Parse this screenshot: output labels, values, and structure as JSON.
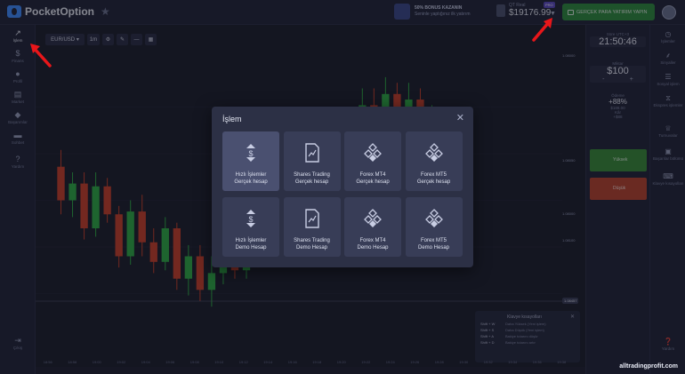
{
  "app": {
    "logo_text": "PocketOption",
    "bonus": {
      "line1": "50% BONUS KAZANIN",
      "line2": "Seninle yaptığınız ilk yatırım"
    },
    "account": {
      "type": "QT Real",
      "balance": "$19176.99",
      "badge": "PRO"
    },
    "real_button_label": "GERÇEK PARA YATIRIM YAPIN"
  },
  "left_nav": [
    {
      "icon": "chart-icon",
      "glyph": "↗",
      "label": "İşlem",
      "active": true
    },
    {
      "icon": "dollar-icon",
      "glyph": "$",
      "label": "Finans",
      "active": false
    },
    {
      "icon": "profile-icon",
      "glyph": "●",
      "label": "Profil",
      "active": false
    },
    {
      "icon": "market-icon",
      "glyph": "▤",
      "label": "Market",
      "active": false
    },
    {
      "icon": "achievements-icon",
      "glyph": "◆",
      "label": "Başarımlar",
      "active": false
    },
    {
      "icon": "chat-icon",
      "glyph": "▬",
      "label": "Sohbet",
      "active": false
    },
    {
      "icon": "help-icon",
      "glyph": "?",
      "label": "Yardım",
      "active": false
    }
  ],
  "left_nav_bottom": {
    "icon": "logout-icon",
    "glyph": "⇥",
    "label": "Çıkış"
  },
  "toolbar": {
    "pair": "EUR/USD",
    "timeframe": "1m"
  },
  "chart_area": {
    "x_ticks": [
      "18:56",
      "18:58",
      "19:00",
      "19:02",
      "19:04",
      "19:06",
      "19:08",
      "19:10",
      "19:12",
      "19:14",
      "19:16",
      "19:18",
      "19:20",
      "19:22",
      "19:24",
      "19:26",
      "19:28",
      "19:30",
      "19:32",
      "19:34",
      "19:36",
      "19:38"
    ],
    "price_tags": [
      "1.08000",
      "1.08050",
      "1.08000",
      "1.08100",
      "1.08457"
    ],
    "highlight_price": "1.08457",
    "candles": [
      [
        0.62,
        0.5,
        0.68,
        0.45
      ],
      [
        0.5,
        0.56,
        0.6,
        0.44
      ],
      [
        0.56,
        0.4,
        0.6,
        0.36
      ],
      [
        0.4,
        0.55,
        0.6,
        0.37
      ],
      [
        0.55,
        0.45,
        0.58,
        0.42
      ],
      [
        0.45,
        0.3,
        0.48,
        0.26
      ],
      [
        0.3,
        0.46,
        0.5,
        0.27
      ],
      [
        0.46,
        0.35,
        0.52,
        0.3
      ],
      [
        0.35,
        0.28,
        0.4,
        0.24
      ],
      [
        0.28,
        0.4,
        0.44,
        0.25
      ],
      [
        0.4,
        0.22,
        0.42,
        0.18
      ],
      [
        0.22,
        0.3,
        0.34,
        0.16
      ],
      [
        0.3,
        0.18,
        0.34,
        0.14
      ],
      [
        0.18,
        0.24,
        0.3,
        0.12
      ],
      [
        0.24,
        0.32,
        0.36,
        0.2
      ],
      [
        0.32,
        0.25,
        0.36,
        0.22
      ],
      [
        0.25,
        0.38,
        0.42,
        0.22
      ],
      [
        0.38,
        0.3,
        0.44,
        0.26
      ],
      [
        0.3,
        0.44,
        0.48,
        0.27
      ],
      [
        0.44,
        0.4,
        0.5,
        0.36
      ],
      [
        0.4,
        0.52,
        0.56,
        0.38
      ],
      [
        0.52,
        0.46,
        0.58,
        0.42
      ],
      [
        0.46,
        0.6,
        0.64,
        0.44
      ],
      [
        0.6,
        0.7,
        0.74,
        0.56
      ],
      [
        0.7,
        0.66,
        0.76,
        0.62
      ],
      [
        0.66,
        0.78,
        0.82,
        0.64
      ],
      [
        0.78,
        0.84,
        0.9,
        0.74
      ],
      [
        0.84,
        0.8,
        0.9,
        0.76
      ],
      [
        0.8,
        0.88,
        0.94,
        0.78
      ],
      [
        0.88,
        0.82,
        0.92,
        0.78
      ],
      [
        0.82,
        0.86,
        0.92,
        0.78
      ],
      [
        0.86,
        0.74,
        0.9,
        0.7
      ],
      [
        0.74,
        0.8,
        0.84,
        0.7
      ]
    ]
  },
  "hotkeys": {
    "title": "Klavye kısayolları",
    "subtitle": "(açık)",
    "rows": [
      {
        "key": "Shift + W",
        "action": "Daha Yüksek (Yeni işlem)"
      },
      {
        "key": "Shift + S",
        "action": "Daha Düşük (Yeni işlem)"
      },
      {
        "key": "Shift + A",
        "action": "Bakiye tutarını düşür"
      },
      {
        "key": "Shift + D",
        "action": "Bakiye tutarını artır"
      }
    ]
  },
  "right_panel": {
    "pending": "Zaman",
    "expiry_label": "Süre UTC+3",
    "expiry_time": "21:50:46",
    "amount_label": "Miktar",
    "amount": "$100",
    "minus": "-",
    "plus": "+",
    "payout_label": "Ödeme",
    "payout_pct": "+88%",
    "payout_value": "$188.00",
    "profit_label": "Kâr",
    "profit_value": "+$88",
    "call_label": "Yüksek",
    "put_label": "Düşük"
  },
  "right_nav": [
    {
      "icon": "trades-icon",
      "glyph": "◷",
      "label": "İşlemler"
    },
    {
      "icon": "signals-icon",
      "glyph": "⸙",
      "label": "Sinyaller"
    },
    {
      "icon": "social-icon",
      "glyph": "☰",
      "label": "Sosyal işlem"
    },
    {
      "icon": "express-icon",
      "glyph": "⧖",
      "label": "Ekspres işlemler"
    },
    {
      "icon": "tournaments-icon",
      "glyph": "♕",
      "label": "Turnuvalar"
    },
    {
      "icon": "achievements-icon",
      "glyph": "▣",
      "label": "Başarılar bölümü"
    },
    {
      "icon": "shortcuts-icon",
      "glyph": "⌨",
      "label": "Klavye kısayolları"
    }
  ],
  "right_nav_bottom": {
    "icon": "help-icon",
    "glyph": "❓",
    "label": "Yardım"
  },
  "modal": {
    "title": "İşlem",
    "cards": [
      {
        "name": "fast-trades-real",
        "icon": "fast-trades-icon",
        "line1": "Hızlı İşlemler",
        "line2": "Gerçek hesap",
        "active": true
      },
      {
        "name": "shares-trading-real",
        "icon": "shares-icon",
        "line1": "Shares Trading",
        "line2": "Gerçek hesap",
        "active": false
      },
      {
        "name": "forex-mt4-real",
        "icon": "mt4-icon",
        "line1": "Forex MT4",
        "line2": "Gerçek hesap",
        "active": false
      },
      {
        "name": "forex-mt5-real",
        "icon": "mt5-icon",
        "line1": "Forex MT5",
        "line2": "Gerçek hesap",
        "active": false
      },
      {
        "name": "fast-trades-demo",
        "icon": "fast-trades-icon",
        "line1": "Hızlı İşlemler",
        "line2": "Demo Hesap",
        "active": false
      },
      {
        "name": "shares-trading-demo",
        "icon": "shares-icon",
        "line1": "Shares Trading",
        "line2": "Demo Hesap",
        "active": false
      },
      {
        "name": "forex-mt4-demo",
        "icon": "mt4-icon",
        "line1": "Forex MT4",
        "line2": "Demo Hesap",
        "active": false
      },
      {
        "name": "forex-mt5-demo",
        "icon": "mt5-icon",
        "line1": "Forex MT5",
        "line2": "Demo Hesap",
        "active": false
      }
    ]
  },
  "colors": {
    "up": "#2fae45",
    "down": "#c9412b",
    "annotation_arrow": "#e8161a"
  },
  "watermark": "alltradingprofit.com"
}
